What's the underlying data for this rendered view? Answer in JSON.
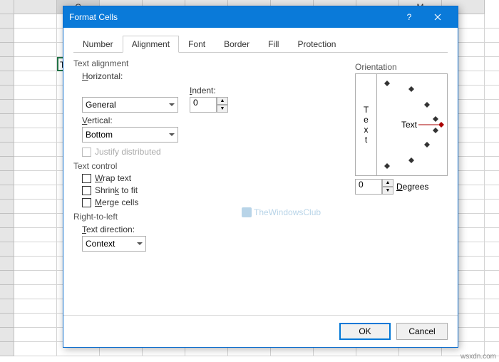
{
  "columns": [
    "",
    "",
    "C",
    "",
    "",
    "",
    "",
    "",
    "",
    "",
    "M"
  ],
  "activeCell": "TWC",
  "dialog": {
    "title": "Format Cells",
    "help": "?",
    "tabs": [
      "Number",
      "Alignment",
      "Font",
      "Border",
      "Fill",
      "Protection"
    ],
    "activeTab": 1,
    "textAlignment": {
      "label": "Text alignment",
      "horizontalLabel": "Horizontal:",
      "horizontalValue": "General",
      "verticalLabel": "Vertical:",
      "verticalValue": "Bottom",
      "indentLabel": "Indent:",
      "indentValue": "0",
      "justifyLabel": "Justify distributed"
    },
    "textControl": {
      "label": "Text control",
      "wrap": "Wrap text",
      "shrink": "Shrink to fit",
      "merge": "Merge cells"
    },
    "rtl": {
      "label": "Right-to-left",
      "textDirLabel": "Text direction:",
      "textDirValue": "Context"
    },
    "orientation": {
      "label": "Orientation",
      "vertText": "Text",
      "horizText": "Text",
      "degreesValue": "0",
      "degreesLabel": "Degrees"
    },
    "buttons": {
      "ok": "OK",
      "cancel": "Cancel"
    }
  },
  "watermark": "TheWindowsClub",
  "credit": "wsxdn.com"
}
